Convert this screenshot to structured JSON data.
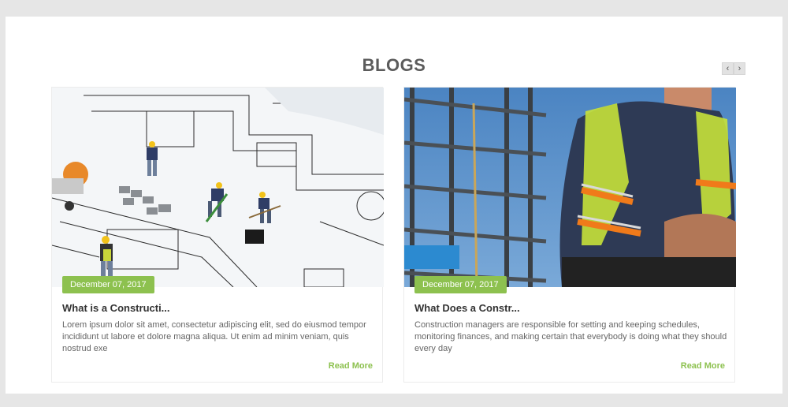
{
  "section": {
    "title": "BLOGS"
  },
  "carousel": {
    "prev_icon": "‹",
    "next_icon": "›"
  },
  "posts": [
    {
      "date": "December 07, 2017",
      "title": "What is a Constructi...",
      "excerpt": "Lorem ipsum dolor sit amet, consectetur adipiscing elit, sed do eiusmod tempor incididunt ut labore et dolore magna aliqua. Ut enim ad minim veniam, quis nostrud exe",
      "read_more": "Read More"
    },
    {
      "date": "December 07, 2017",
      "title": "What Does a Constr...",
      "excerpt": "Construction managers are responsible for setting and keeping schedules, monitoring finances, and making certain that everybody is doing what they should every day",
      "read_more": "Read More"
    }
  ],
  "colors": {
    "accent": "#8dc14f",
    "background": "#e6e6e6"
  }
}
